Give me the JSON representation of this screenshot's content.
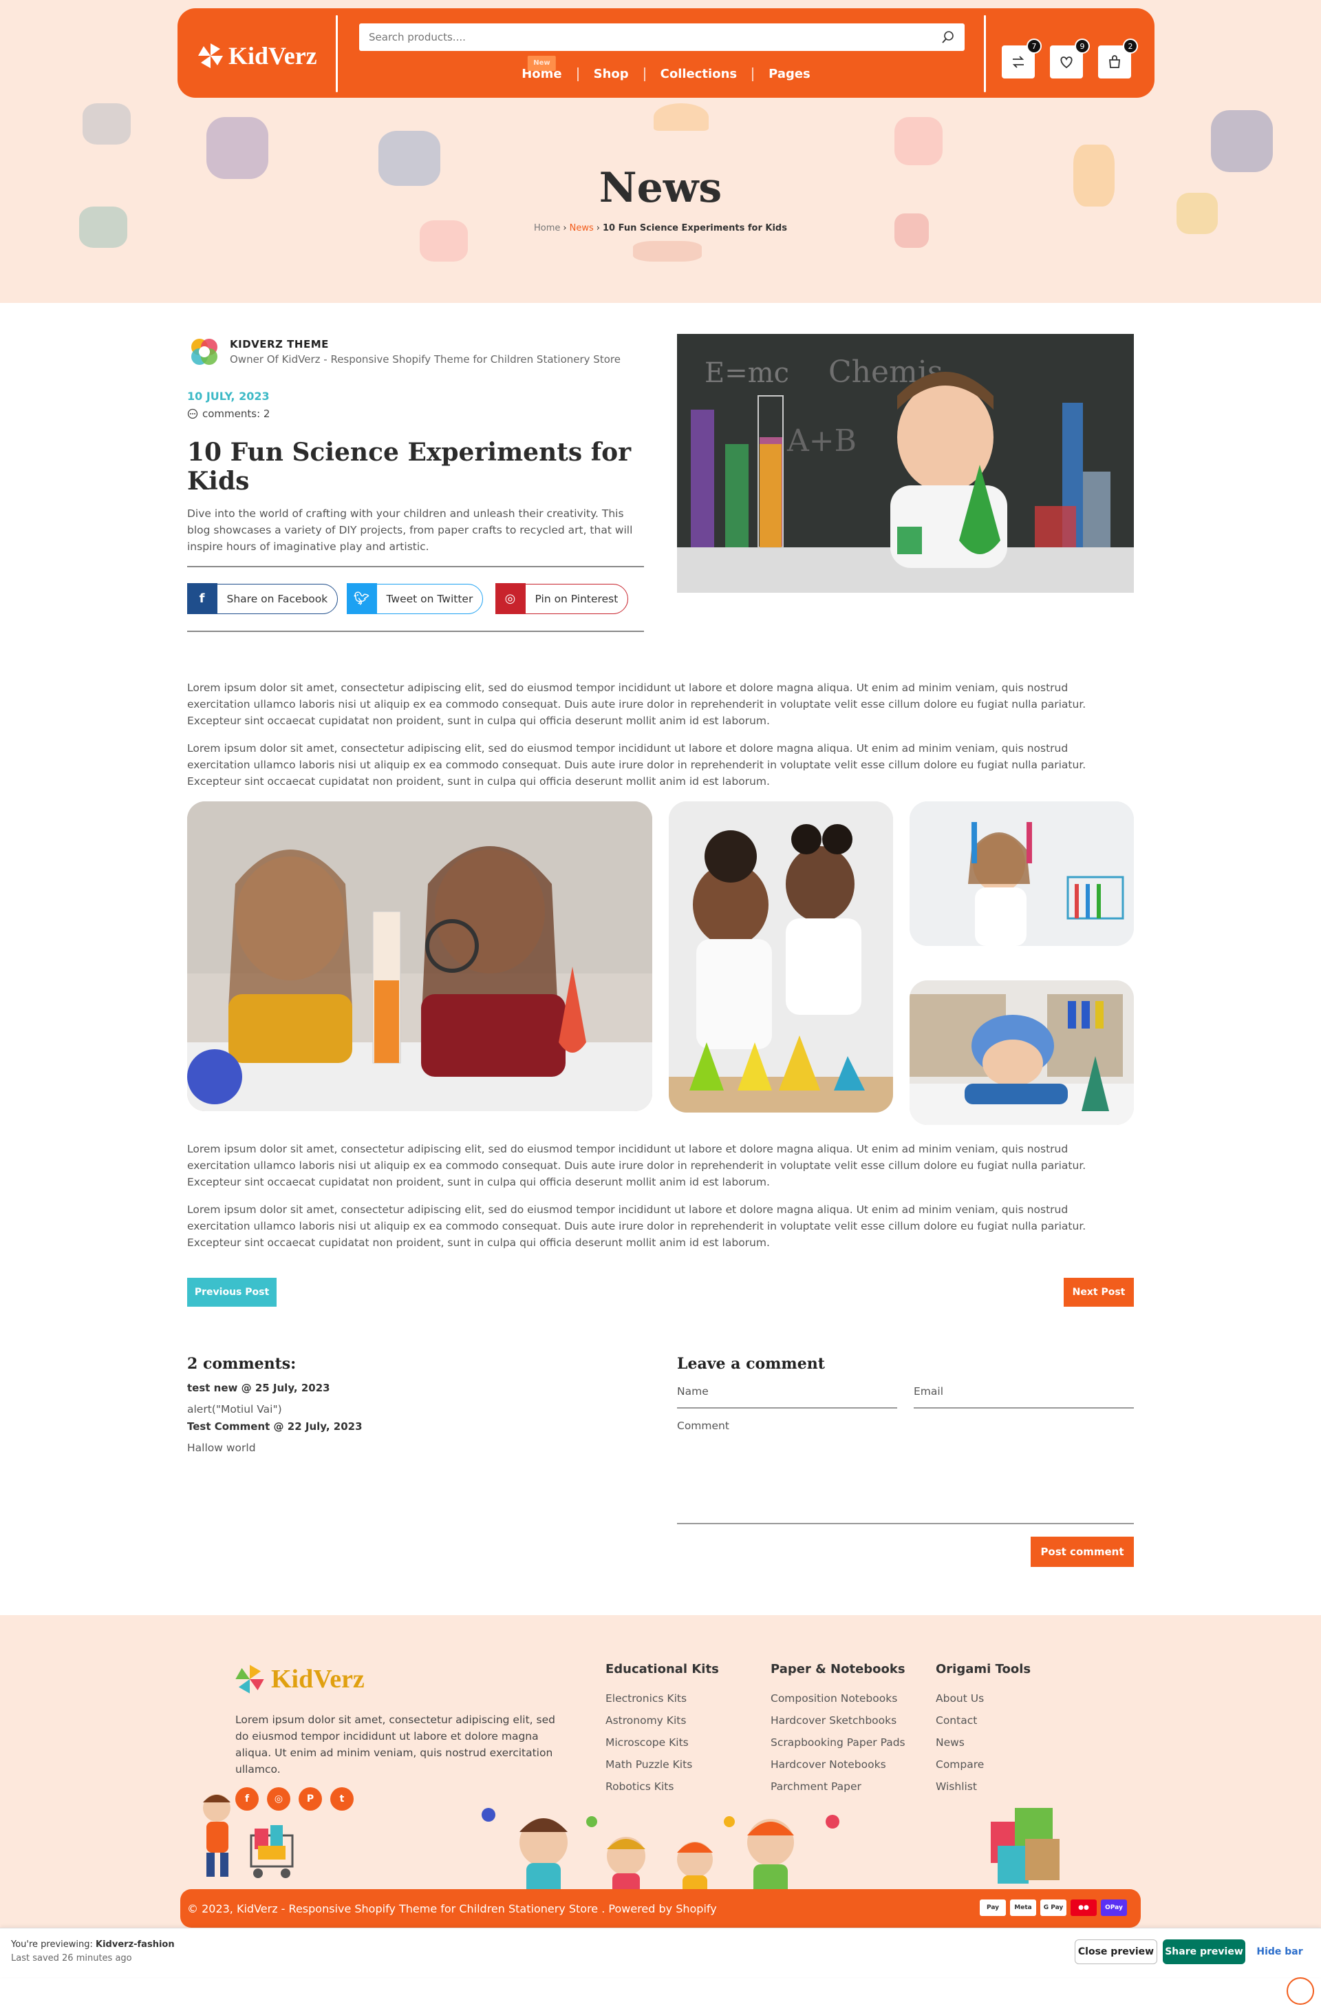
{
  "header": {
    "logo": "KidVerz",
    "search_placeholder": "Search products....",
    "nav": [
      {
        "label": "Home",
        "badge": "New"
      },
      {
        "label": "Shop",
        "badge": ""
      },
      {
        "label": "Collections",
        "badge": ""
      },
      {
        "label": "Pages",
        "badge": ""
      }
    ],
    "counts": {
      "compare": "7",
      "wishlist": "9",
      "cart": "2"
    },
    "icons": [
      "search-icon",
      "compare-icon",
      "heart-icon",
      "cart-icon"
    ]
  },
  "hero": {
    "title": "News",
    "breadcrumb": {
      "home": "Home",
      "news": "News",
      "current": "10 Fun Science Experiments for Kids"
    }
  },
  "post": {
    "author_name": "KIDVERZ THEME",
    "author_role": "Owner Of KidVerz - Responsive Shopify Theme for Children Stationery Store",
    "date": "10 JULY, 2023",
    "comments": "comments: 2",
    "title": "10 Fun Science Experiments for Kids",
    "excerpt": "Dive into the world of crafting with your children and unleash their creativity. This blog showcases a variety of DIY projects, from paper crafts to recycled art, that will inspire hours of imaginative play and artistic.",
    "share": {
      "facebook": "Share on Facebook",
      "twitter": "Tweet on Twitter",
      "pinterest": "Pin on Pinterest"
    },
    "paragraphs": [
      "Lorem ipsum dolor sit amet, consectetur adipiscing elit, sed do eiusmod tempor incididunt ut labore et dolore magna aliqua. Ut enim ad minim veniam, quis nostrud exercitation ullamco laboris nisi ut aliquip ex ea commodo consequat. Duis aute irure dolor in reprehenderit in voluptate velit esse cillum dolore eu fugiat nulla pariatur. Excepteur sint occaecat cupidatat non proident, sunt in culpa qui officia deserunt mollit anim id est laborum.",
      "Lorem ipsum dolor sit amet, consectetur adipiscing elit, sed do eiusmod tempor incididunt ut labore et dolore magna aliqua. Ut enim ad minim veniam, quis nostrud exercitation ullamco laboris nisi ut aliquip ex ea commodo consequat. Duis aute irure dolor in reprehenderit in voluptate velit esse cillum dolore eu fugiat nulla pariatur. Excepteur sint occaecat cupidatat non proident, sunt in culpa qui officia deserunt mollit anim id est laborum.",
      "Lorem ipsum dolor sit amet, consectetur adipiscing elit, sed do eiusmod tempor incididunt ut labore et dolore magna aliqua. Ut enim ad minim veniam, quis nostrud exercitation ullamco laboris nisi ut aliquip ex ea commodo consequat. Duis aute irure dolor in reprehenderit in voluptate velit esse cillum dolore eu fugiat nulla pariatur. Excepteur sint occaecat cupidatat non proident, sunt in culpa qui officia deserunt mollit anim id est laborum.",
      "Lorem ipsum dolor sit amet, consectetur adipiscing elit, sed do eiusmod tempor incididunt ut labore et dolore magna aliqua. Ut enim ad minim veniam, quis nostrud exercitation ullamco laboris nisi ut aliquip ex ea commodo consequat. Duis aute irure dolor in reprehenderit in voluptate velit esse cillum dolore eu fugiat nulla pariatur. Excepteur sint occaecat cupidatat non proident, sunt in culpa qui officia deserunt mollit anim id est laborum."
    ],
    "prev_label": "Previous Post",
    "next_label": "Next Post"
  },
  "comments": {
    "heading": "2 comments:",
    "items": [
      {
        "meta": "test new @ 25 July, 2023",
        "text": "alert(\"Motiul Vai\")"
      },
      {
        "meta": "Test Comment @ 22 July, 2023",
        "text": "Hallow world"
      }
    ],
    "form": {
      "heading": "Leave a comment",
      "name_placeholder": "Name",
      "email_placeholder": "Email",
      "comment_placeholder": "Comment",
      "submit_label": "Post comment"
    }
  },
  "footer": {
    "logo": "KidVerz",
    "description": "Lorem ipsum dolor sit amet, consectetur adipiscing elit, sed do eiusmod tempor incididunt ut labore et dolore magna aliqua. Ut enim ad minim veniam, quis nostrud exercitation ullamco.",
    "social": [
      "f",
      "◎",
      "P",
      "t"
    ],
    "columns": [
      {
        "title": "Educational Kits",
        "links": [
          "Electronics Kits",
          "Astronomy Kits",
          "Microscope Kits",
          "Math Puzzle Kits",
          "Robotics Kits"
        ]
      },
      {
        "title": "Paper & Notebooks",
        "links": [
          "Composition Notebooks",
          "Hardcover Sketchbooks",
          "Scrapbooking Paper Pads",
          "Hardcover Notebooks",
          "Parchment Paper"
        ]
      },
      {
        "title": "Origami Tools",
        "links": [
          "About Us",
          "Contact",
          "News",
          "Compare",
          "Wishlist"
        ]
      }
    ],
    "copyright": "© 2023, KidVerz - Responsive Shopify Theme for Children Stationery Store . Powered by Shopify",
    "payments": [
      "Pay",
      "Meta",
      "G Pay",
      "MC",
      "OPay"
    ]
  },
  "preview_bar": {
    "prefix": "You're previewing: ",
    "store": "Kidverz-fashion",
    "saved": "Last saved 26 minutes ago",
    "close": "Close preview",
    "share": "Share preview",
    "hide": "Hide bar"
  },
  "colors": {
    "brand": "#f25d1c",
    "teal": "#3cb9c6",
    "facebook": "#1f4e8c",
    "twitter": "#1da1f2",
    "pinterest": "#c8232c",
    "hero_bg": "#fde8dc"
  }
}
